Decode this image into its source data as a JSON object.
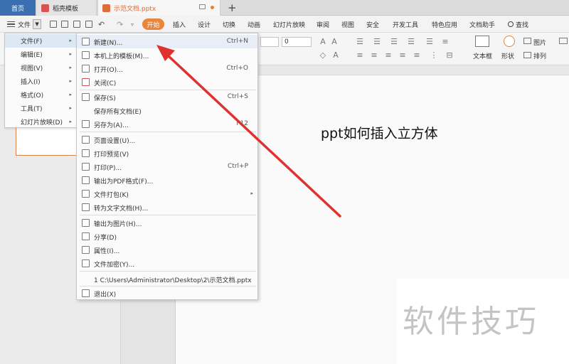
{
  "tabs": {
    "home": "首页",
    "template": "稻壳模板",
    "document": "示范文档.pptx",
    "add": "+"
  },
  "toolbar": {
    "file": "文件",
    "start": "开始",
    "menus": [
      "插入",
      "设计",
      "切换",
      "动画",
      "幻灯片放映",
      "审阅",
      "视图",
      "安全",
      "开发工具",
      "特色应用",
      "文档助手"
    ],
    "search": "查找"
  },
  "ribbon": {
    "font_size": "0",
    "textbox": "文本框",
    "shape": "形状",
    "picture": "图片",
    "arrange": "排列"
  },
  "category_menu": [
    {
      "label": "文件(F)"
    },
    {
      "label": "编辑(E)"
    },
    {
      "label": "视图(V)"
    },
    {
      "label": "插入(I)"
    },
    {
      "label": "格式(O)"
    },
    {
      "label": "工具(T)"
    },
    {
      "label": "幻灯片放映(D)"
    }
  ],
  "file_menu": {
    "items": [
      {
        "label": "新建(N)...",
        "shortcut": "Ctrl+N"
      },
      {
        "label": "本机上的模板(M)...",
        "shortcut": ""
      },
      {
        "label": "打开(O)...",
        "shortcut": "Ctrl+O"
      },
      {
        "label": "关闭(C)",
        "shortcut": ""
      },
      {
        "label": "保存(S)",
        "shortcut": "Ctrl+S"
      },
      {
        "label": "保存所有文档(E)",
        "shortcut": ""
      },
      {
        "label": "另存为(A)...",
        "shortcut": "F12"
      },
      {
        "label": "页面设置(U)...",
        "shortcut": ""
      },
      {
        "label": "打印预览(V)",
        "shortcut": ""
      },
      {
        "label": "打印(P)...",
        "shortcut": "Ctrl+P"
      },
      {
        "label": "输出为PDF格式(F)...",
        "shortcut": ""
      },
      {
        "label": "文件打包(K)",
        "shortcut": ""
      },
      {
        "label": "转为文字文档(H)...",
        "shortcut": ""
      },
      {
        "label": "输出为图片(H)...",
        "shortcut": ""
      },
      {
        "label": "分享(D)",
        "shortcut": ""
      },
      {
        "label": "属性(I)...",
        "shortcut": ""
      },
      {
        "label": "文件加密(Y)...",
        "shortcut": ""
      },
      {
        "label": "1 C:\\Users\\Administrator\\Desktop\\2\\示范文档.pptx",
        "shortcut": ""
      },
      {
        "label": "退出(X)",
        "shortcut": ""
      }
    ]
  },
  "slide": {
    "title": "ppt如何插入立方体"
  },
  "watermark": "软件技巧",
  "colors": {
    "accent": "#e8863c",
    "arrow": "#e03131",
    "home_tab": "#3a6fb0"
  }
}
